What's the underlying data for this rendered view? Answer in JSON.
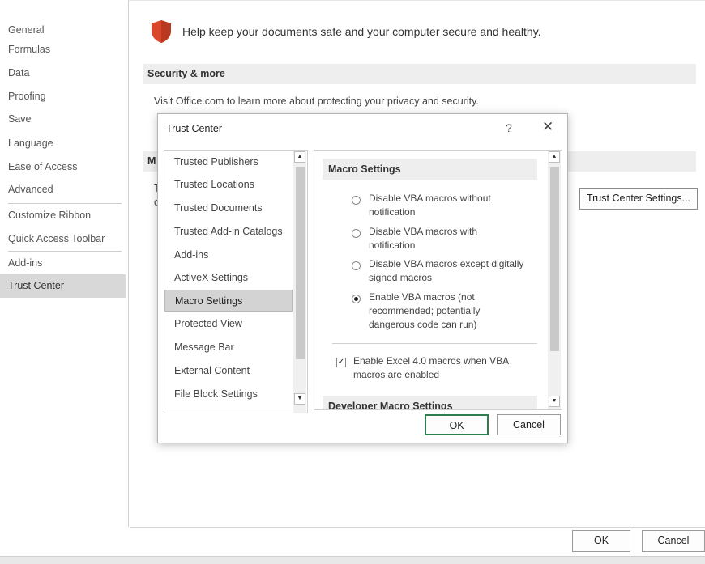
{
  "sidebar": {
    "items": [
      {
        "label": "General"
      },
      {
        "label": "Formulas"
      },
      {
        "label": "Data"
      },
      {
        "label": "Proofing"
      },
      {
        "label": "Save"
      },
      {
        "label": "Language"
      },
      {
        "label": "Ease of Access"
      },
      {
        "label": "Advanced"
      },
      {
        "label": "Customize Ribbon"
      },
      {
        "label": "Quick Access Toolbar"
      },
      {
        "label": "Add-ins"
      },
      {
        "label": "Trust Center"
      }
    ],
    "selected": "Trust Center"
  },
  "main": {
    "headline": "Help keep your documents safe and your computer secure and healthy.",
    "security_section": "Security & more",
    "visit_text": "Visit Office.com to learn more about protecting your privacy and security.",
    "section_fragment": "M",
    "body_fragment_1": "T",
    "body_fragment_2": "c",
    "trust_center_settings_button": "Trust Center Settings...",
    "ok_button": "OK",
    "cancel_button": "Cancel"
  },
  "dialog": {
    "title": "Trust Center",
    "help_glyph": "?",
    "close_glyph": "✕",
    "nav_items": [
      {
        "label": "Trusted Publishers"
      },
      {
        "label": "Trusted Locations"
      },
      {
        "label": "Trusted Documents"
      },
      {
        "label": "Trusted Add-in Catalogs"
      },
      {
        "label": "Add-ins"
      },
      {
        "label": "ActiveX Settings"
      },
      {
        "label": "Macro Settings"
      },
      {
        "label": "Protected View"
      },
      {
        "label": "Message Bar"
      },
      {
        "label": "External Content"
      },
      {
        "label": "File Block Settings"
      }
    ],
    "selected_nav": "Macro Settings",
    "content": {
      "heading": "Macro Settings",
      "options": [
        {
          "label": "Disable VBA macros without notification",
          "line1": "Disable VBA macros without",
          "line2": "notification",
          "selected": false
        },
        {
          "label": "Disable VBA macros with notification",
          "line1": "Disable VBA macros with",
          "line2": "notification",
          "selected": false
        },
        {
          "label": "Disable VBA macros except digitally signed macros",
          "line1": "Disable VBA macros except digitally",
          "line2": "signed macros",
          "selected": false
        },
        {
          "label": "Enable VBA macros (not recommended; potentially dangerous code can run)",
          "line1": "Enable VBA macros (not",
          "line2": "recommended; potentially",
          "line3": "dangerous code can run)",
          "selected": true
        }
      ],
      "excel4_checkbox": {
        "line1": "Enable Excel 4.0 macros when VBA",
        "line2": "macros are enabled",
        "checked": true
      },
      "next_heading": "Developer Macro Settings"
    },
    "ok_button": "OK",
    "cancel_button": "Cancel"
  },
  "colors": {
    "shield": "#d9482b",
    "selected_bg": "#d3d3d3",
    "ok_border": "#2e7d4f"
  },
  "icons": [
    "shield-icon",
    "help-icon",
    "close-icon",
    "scroll-up-icon",
    "scroll-down-icon",
    "radio-icon",
    "checkbox-icon"
  ]
}
